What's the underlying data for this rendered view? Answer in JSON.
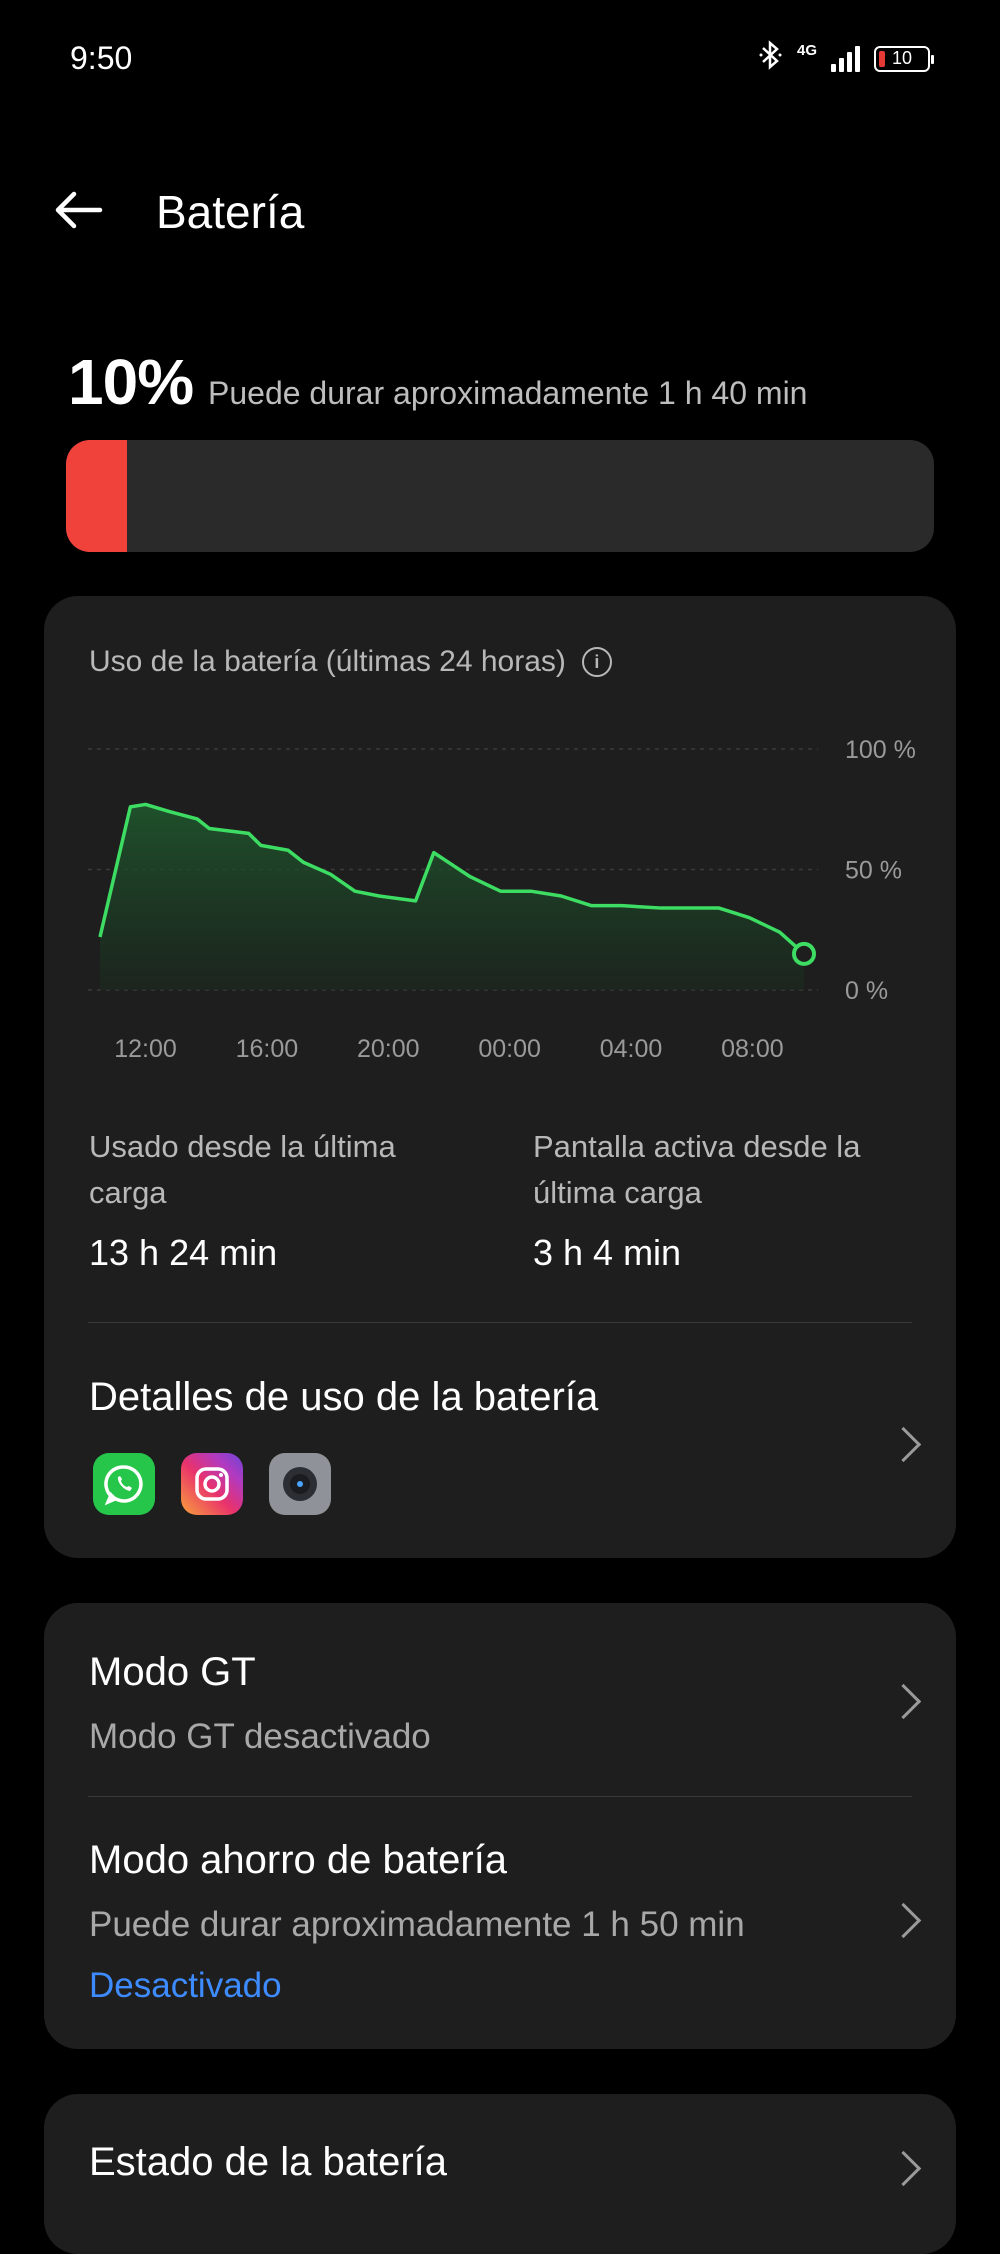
{
  "status_bar": {
    "time": "9:50",
    "network": "4G",
    "battery_level": "10"
  },
  "header": {
    "title": "Batería"
  },
  "battery": {
    "percent": "10%",
    "percent_value": 10,
    "estimate": "Puede durar aproximadamente 1 h 40 min",
    "fill_color": "#f0413a"
  },
  "usage_card": {
    "title": "Uso de la batería (últimas 24 horas)",
    "used_label": "Usado desde la última carga",
    "used_value": "13 h 24 min",
    "screen_label": "Pantalla activa desde la última carga",
    "screen_value": "3 h 4 min",
    "details_title": "Detalles de uso de la batería",
    "apps": [
      "whatsapp-icon",
      "instagram-icon",
      "camera-icon"
    ]
  },
  "chart_data": {
    "type": "area",
    "title": "Uso de la batería (últimas 24 horas)",
    "x_ticks": [
      "12:00",
      "16:00",
      "20:00",
      "00:00",
      "04:00",
      "08:00"
    ],
    "y_ticks": [
      "100 %",
      "50 %",
      "0 %"
    ],
    "ylim": [
      0,
      100
    ],
    "x_hours_since_start": [
      0,
      1,
      1.5,
      2.3,
      3.2,
      3.6,
      4.9,
      5.3,
      6.2,
      6.7,
      7.6,
      8.4,
      9.2,
      10.4,
      11,
      11.6,
      12.2,
      13.2,
      14.2,
      15.2,
      16.2,
      17.2,
      18.5,
      19.4,
      20.4,
      21.4,
      22.4,
      23.2
    ],
    "values": [
      22,
      76,
      77,
      74,
      71,
      67,
      65,
      60,
      58,
      53,
      48,
      41,
      39,
      37,
      57,
      52,
      47,
      41,
      41,
      39,
      35,
      35,
      34,
      34,
      34,
      30,
      24,
      15
    ],
    "series_color": "#3ddc62",
    "grid": true
  },
  "gt_mode": {
    "title": "Modo GT",
    "status": "Modo GT desactivado"
  },
  "saver_mode": {
    "title": "Modo ahorro de batería",
    "estimate": "Puede durar aproximadamente 1 h 50 min",
    "status": "Desactivado",
    "status_color": "#3d8bff"
  },
  "health": {
    "title": "Estado de la batería"
  }
}
